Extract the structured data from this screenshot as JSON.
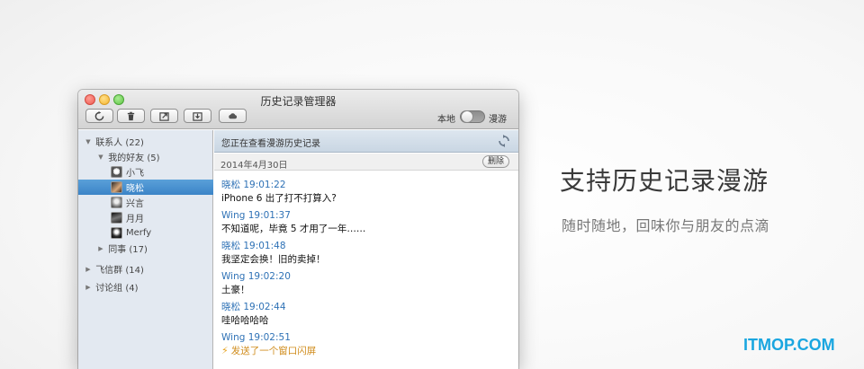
{
  "window": {
    "title": "历史记录管理器",
    "toolbar_buttons": [
      {
        "name": "refresh-icon"
      },
      {
        "name": "trash-icon"
      },
      {
        "name": "export-icon"
      },
      {
        "name": "import-icon"
      },
      {
        "name": "cloud-icon"
      }
    ],
    "mode_local": "本地",
    "mode_roam": "漫游"
  },
  "sidebar": {
    "items": [
      {
        "label": "联系人 (22)",
        "level": 0,
        "expanded": true
      },
      {
        "label": "我的好友 (5)",
        "level": 1,
        "expanded": true
      },
      {
        "label": "小飞",
        "level": 2,
        "avatar": "av1"
      },
      {
        "label": "晓松",
        "level": 2,
        "avatar": "av2",
        "selected": true
      },
      {
        "label": "兴言",
        "level": 2,
        "avatar": "av3"
      },
      {
        "label": "月月",
        "level": 2,
        "avatar": "av4"
      },
      {
        "label": "Merfy",
        "level": 2,
        "avatar": "av5"
      },
      {
        "label": "同事 (17)",
        "level": 1,
        "expanded": false
      },
      {
        "label": "飞信群 (14)",
        "level": 0,
        "expanded": false
      },
      {
        "label": "讨论组 (4)",
        "level": 0,
        "expanded": false
      }
    ]
  },
  "main": {
    "header": "您正在查看漫游历史记录",
    "date": "2014年4月30日",
    "delete_label": "删除",
    "messages": [
      {
        "sender": "晓松 19:01:22",
        "text": "iPhone 6 出了打不打算入?"
      },
      {
        "sender": "Wing 19:01:37",
        "text": "不知道呢，毕竟 5 才用了一年……"
      },
      {
        "sender": "晓松 19:01:48",
        "text": "我坚定会换！旧的卖掉！"
      },
      {
        "sender": "Wing 19:02:20",
        "text": "土豪！"
      },
      {
        "sender": "晓松 19:02:44",
        "text": "哇哈哈哈哈"
      },
      {
        "sender": "Wing 19:02:51",
        "text": "发送了一个窗口闪屏",
        "type": "shake"
      }
    ]
  },
  "promo": {
    "headline": "支持历史记录漫游",
    "subline": "随时随地，回味你与朋友的点滴"
  },
  "watermark": "ITMOP.COM",
  "colors": {
    "accent": "#3b84c7",
    "sender": "#2f72b6",
    "watermark": "#1aa6e0"
  }
}
